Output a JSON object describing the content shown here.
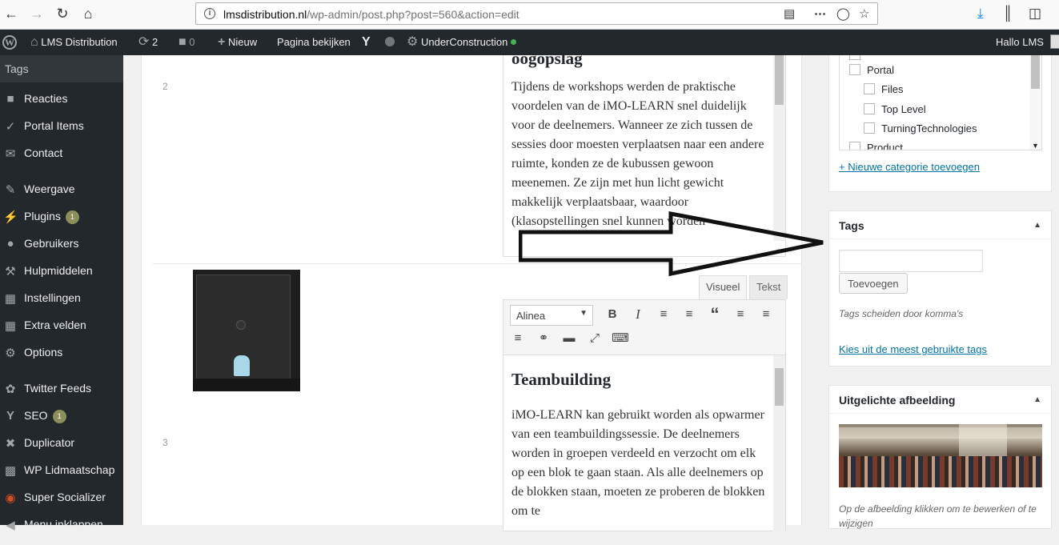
{
  "browser": {
    "url_domain": "lmsdistribution.nl",
    "url_path": "/wp-admin/post.php?post=560&action=edit",
    "icons": [
      "back-icon",
      "forward-icon",
      "reload-icon",
      "home-icon",
      "reader-icon",
      "more-icon",
      "pocket-icon",
      "bookmark-star-icon",
      "download-icon",
      "library-icon",
      "sidebar-icon"
    ]
  },
  "adminbar": {
    "site_name": "LMS Distribution",
    "updates_count": "2",
    "comments_count": "0",
    "new_label": "Nieuw",
    "view_page_label": "Pagina bekijken",
    "plugin_label": "UnderConstruction",
    "greeting": "Hallo LMS"
  },
  "sidebar": {
    "current": "Tags",
    "items": [
      {
        "label": "Reacties",
        "icon": "comment-icon"
      },
      {
        "label": "Portal Items",
        "icon": "pin-icon"
      },
      {
        "label": "Contact",
        "icon": "mail-icon"
      },
      {
        "label": "Weergave",
        "icon": "brush-icon"
      },
      {
        "label": "Plugins",
        "icon": "plug-icon",
        "badge": "1"
      },
      {
        "label": "Gebruikers",
        "icon": "user-icon"
      },
      {
        "label": "Hulpmiddelen",
        "icon": "wrench-icon"
      },
      {
        "label": "Instellingen",
        "icon": "settings-icon"
      },
      {
        "label": "Extra velden",
        "icon": "table-icon"
      },
      {
        "label": "Options",
        "icon": "gear-icon"
      },
      {
        "label": "Twitter Feeds",
        "icon": "twitter-icon"
      },
      {
        "label": "SEO",
        "icon": "yoast-icon",
        "badge": "1"
      },
      {
        "label": "Duplicator",
        "icon": "share-icon"
      },
      {
        "label": "WP Lidmaatschap",
        "icon": "id-card-icon"
      },
      {
        "label": "Super Socializer",
        "icon": "socializer-icon"
      },
      {
        "label": "Menu inklappen",
        "icon": "collapse-icon"
      }
    ]
  },
  "content": {
    "row2": {
      "number": "2",
      "heading_partial": "oogopslag",
      "text": "Tijdens de workshops werden de praktische voordelen van de iMO-LEARN snel duidelijk voor de deelnemers. Wanneer ze zich tussen de sessies door moesten verplaatsen naar een andere ruimte, konden ze de kubussen gewoon meenemen. Ze zijn met hun licht gewicht makkelijk verplaatsbaar, waardoor (klasopstellingen snel kunnen worden"
    },
    "row3": {
      "number": "3",
      "tab_visual": "Visueel",
      "tab_text": "Tekst",
      "format_select": "Alinea",
      "heading": "Teambuilding",
      "text": "iMO-LEARN kan gebruikt worden als opwarmer van een teambuildingssessie. De deelnemers worden in groepen verdeeld en verzocht om elk op een blok te gaan staan. Als alle deelnemers op de blokken staan, moeten ze proberen de blokken om te"
    }
  },
  "categories": {
    "items": [
      "Portal",
      "Files",
      "Top Level",
      "TurningTechnologies",
      "Product"
    ],
    "add_link": "+ Nieuwe categorie toevoegen"
  },
  "tags_box": {
    "title": "Tags",
    "input_value": "",
    "add_button": "Toevoegen",
    "hint": "Tags scheiden door komma's",
    "popular_link": "Kies uit de meest gebruikte tags"
  },
  "featured_box": {
    "title": "Uitgelichte afbeelding",
    "hint": "Op de afbeelding klikken om te bewerken of te wijzigen"
  },
  "colors": {
    "admin_bar": "#23282d",
    "link": "#0073aa",
    "status_dot": "#46b450"
  }
}
